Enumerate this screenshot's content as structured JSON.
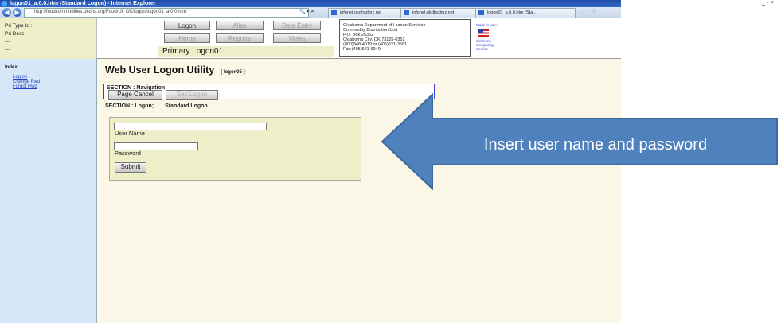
{
  "window": {
    "title": "logon01_a.0.0.htm (Standard Logon) - Internet Explorer",
    "address": "http://foodcommodities.okdhs.org/Food/UI_OK/logon/logon01_a.0.0.htm",
    "tabs": [
      "infonet.okdhsdmz.net",
      "infonet.okdhsdmz.net",
      "logon01_a.0.0.htm (Sta..."
    ],
    "controls": "_ ▫ ×"
  },
  "header": {
    "pri_type_label": "Pri Type Id  :",
    "pri_desc_label": "Pri Desc",
    "dash1": "---",
    "dash2": "---",
    "buttons": {
      "logon": "Logon",
      "alias": "Alias",
      "data_entry": "Data Entry",
      "home": "Home",
      "reports": "Reports",
      "views": "Views"
    },
    "page_title": "Primary Logon01",
    "address_lines": [
      "Oklahoma Department of Human Services",
      "Commodity Distribution Unit",
      "P.O. Box 25352",
      "Oklahoma City, OK 73125-0352",
      "(800)848-4019 or (405)521-3581",
      "Fax:(405)521-6949"
    ],
    "made_in_usa": "Made in USA",
    "vendor_lines": [
      "Simmons",
      "Computing",
      "Service"
    ]
  },
  "sidebar": {
    "index_label": "Index",
    "items": [
      {
        "label": "Log on"
      },
      {
        "label": "Change Pwd"
      },
      {
        "label": "Forgot Pwd"
      }
    ]
  },
  "main": {
    "title": "Web User Logon Utility",
    "page_code": "[ logon05 ]",
    "nav_section_label": "SECTION : Navigation",
    "page_cancel": "Page Cancel",
    "sec_logon": "Sec Logon",
    "logon_section_label": "SECTION :  Logon;",
    "logon_section_sub": "Standard Logon",
    "username_label": "User Name",
    "username_value": "",
    "password_label": "Password",
    "password_value": "",
    "submit_label": "Submit"
  },
  "callout": {
    "text": "Insert user name and password",
    "fill": "#4f81bd",
    "stroke": "#3b6aa0"
  }
}
